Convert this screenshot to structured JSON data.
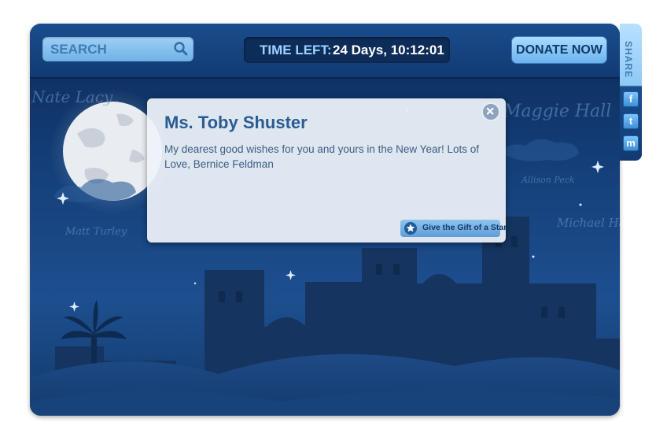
{
  "header": {
    "search": {
      "placeholder": "SEARCH",
      "value": ""
    },
    "timer": {
      "label": "TIME LEFT:",
      "value": "24 Days, 10:12:01"
    },
    "donate_label": "DONATE NOW"
  },
  "share": {
    "label": "SHARE",
    "buttons": [
      {
        "name": "facebook",
        "glyph": "f"
      },
      {
        "name": "twitter",
        "glyph": "t"
      },
      {
        "name": "myspace",
        "glyph": "m"
      }
    ]
  },
  "background_names": [
    "Nate Lacy",
    "Maggie Hall",
    "Allison Peck",
    "Matt Turley",
    "Michael Ha"
  ],
  "popup": {
    "name": "Ms. Toby Shuster",
    "message": "My dearest good wishes for you and yours in the New Year! Lots of Love, Bernice Feldman",
    "gift_label": "Give the Gift of a Star"
  },
  "colors": {
    "sky_top": "#0b2a55",
    "sky_bottom": "#1d4f8f",
    "accent_light": "#9ed3ff",
    "popup_title": "#2b5b93"
  }
}
